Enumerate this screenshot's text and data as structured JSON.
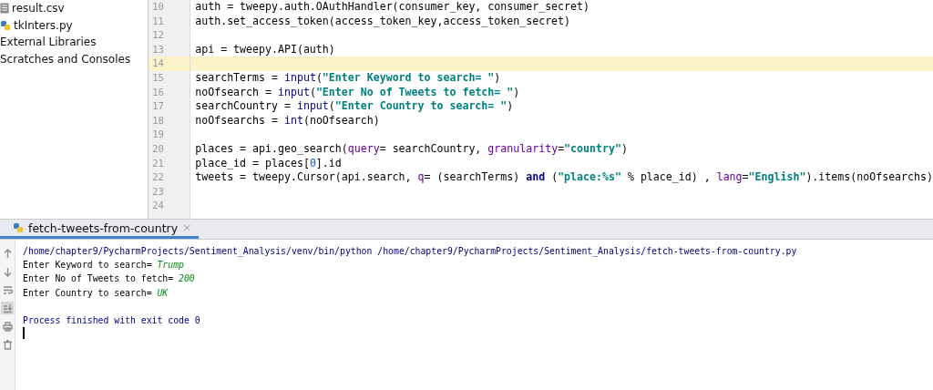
{
  "project_tree": {
    "items": [
      {
        "label": "result.csv",
        "kind": "csv"
      },
      {
        "label": "tkInters.py",
        "kind": "python"
      },
      {
        "label": "External Libraries",
        "kind": "group"
      },
      {
        "label": "Scratches and Consoles",
        "kind": "group"
      }
    ]
  },
  "editor": {
    "lines": [
      {
        "number": "10",
        "current": false,
        "tokens": [
          {
            "text": "auth = tweepy.auth.OAuthHandler(consumer_key, consumer_secret)",
            "kind": "plain"
          }
        ]
      },
      {
        "number": "11",
        "current": false,
        "tokens": [
          {
            "text": "auth.set_access_token(access_token_key,access_token_secret)",
            "kind": "plain"
          }
        ]
      },
      {
        "number": "12",
        "current": false
      },
      {
        "number": "13",
        "current": false,
        "tokens": [
          {
            "text": "api = tweepy.API(auth)",
            "kind": "plain"
          }
        ]
      },
      {
        "number": "14",
        "current": true
      },
      {
        "number": "15",
        "current": false,
        "tokens": [
          {
            "text": "searchTerms = ",
            "kind": "plain"
          },
          {
            "text": "input",
            "kind": "builtin"
          },
          {
            "text": "(",
            "kind": "plain"
          },
          {
            "text": "\"Enter Keyword to search= \"",
            "kind": "string"
          },
          {
            "text": ")",
            "kind": "plain"
          }
        ]
      },
      {
        "number": "16",
        "current": false,
        "tokens": [
          {
            "text": "noOfsearch = ",
            "kind": "plain"
          },
          {
            "text": "input",
            "kind": "builtin"
          },
          {
            "text": "(",
            "kind": "plain"
          },
          {
            "text": "\"Enter No of Tweets to fetch= \"",
            "kind": "string"
          },
          {
            "text": ")",
            "kind": "plain"
          }
        ]
      },
      {
        "number": "17",
        "current": false,
        "tokens": [
          {
            "text": "searchCountry = ",
            "kind": "plain"
          },
          {
            "text": "input",
            "kind": "builtin"
          },
          {
            "text": "(",
            "kind": "plain"
          },
          {
            "text": "\"Enter Country to search= \"",
            "kind": "string"
          },
          {
            "text": ")",
            "kind": "plain"
          }
        ]
      },
      {
        "number": "18",
        "current": false,
        "tokens": [
          {
            "text": "noOfsearchs = ",
            "kind": "plain"
          },
          {
            "text": "int",
            "kind": "builtin"
          },
          {
            "text": "(noOfsearch)",
            "kind": "plain"
          }
        ]
      },
      {
        "number": "19",
        "current": false
      },
      {
        "number": "20",
        "current": false,
        "tokens": [
          {
            "text": "places = api.geo_search(",
            "kind": "plain"
          },
          {
            "text": "query",
            "kind": "param"
          },
          {
            "text": "= searchCountry, ",
            "kind": "plain"
          },
          {
            "text": "granularity",
            "kind": "param"
          },
          {
            "text": "=",
            "kind": "plain"
          },
          {
            "text": "\"country\"",
            "kind": "string"
          },
          {
            "text": ")",
            "kind": "plain"
          }
        ]
      },
      {
        "number": "21",
        "current": false,
        "tokens": [
          {
            "text": "place_id = places[",
            "kind": "plain"
          },
          {
            "text": "0",
            "kind": "number"
          },
          {
            "text": "].id",
            "kind": "plain"
          }
        ]
      },
      {
        "number": "22",
        "current": false,
        "tokens": [
          {
            "text": "tweets = tweepy.Cursor(api.search, ",
            "kind": "plain"
          },
          {
            "text": "q",
            "kind": "param"
          },
          {
            "text": "= (searchTerms) ",
            "kind": "plain"
          },
          {
            "text": "and",
            "kind": "keyword"
          },
          {
            "text": " (",
            "kind": "plain"
          },
          {
            "text": "\"place:%s\"",
            "kind": "string"
          },
          {
            "text": " % place_id) , ",
            "kind": "plain"
          },
          {
            "text": "lang",
            "kind": "param"
          },
          {
            "text": "=",
            "kind": "plain"
          },
          {
            "text": "\"English\"",
            "kind": "string"
          },
          {
            "text": ").items(noOfsearchs)",
            "kind": "plain"
          }
        ]
      },
      {
        "number": "23",
        "current": false
      },
      {
        "number": "24",
        "current": false
      }
    ]
  },
  "run_panel": {
    "tab": {
      "label": "fetch-tweets-from-country",
      "close": "×",
      "selected": true
    },
    "lines": [
      {
        "kind": "system",
        "text": "/home/chapter9/PycharmProjects/Sentiment_Analysis/venv/bin/python /home/chapter9/PycharmProjects/Sentiment_Analysis/fetch-tweets-from-country.py"
      },
      {
        "kind": "prompt",
        "text": "Enter Keyword to search= ",
        "input": "Trump"
      },
      {
        "kind": "prompt",
        "text": "Enter No of Tweets to fetch= ",
        "input": "200"
      },
      {
        "kind": "prompt",
        "text": "Enter Country to search= ",
        "input": "UK"
      },
      {
        "kind": "blank"
      },
      {
        "kind": "system",
        "text": "Process finished with exit code 0"
      }
    ]
  }
}
